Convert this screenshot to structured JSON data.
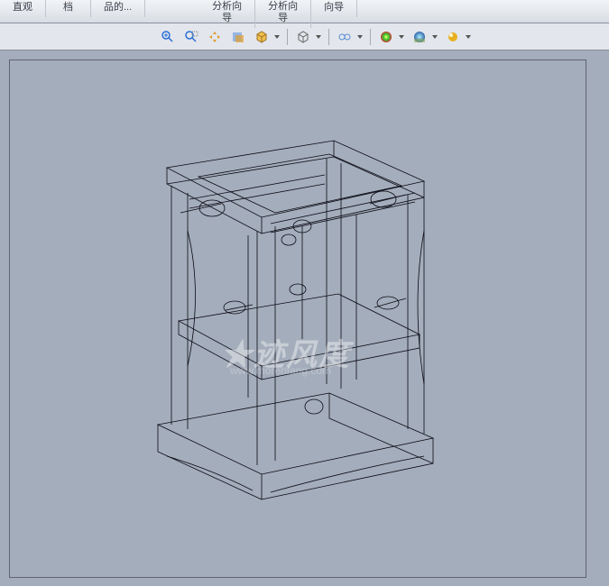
{
  "menu": {
    "view": "直观",
    "dang": "档",
    "pinde": "品的...",
    "analysis_wizard1_l1": "分析向",
    "analysis_wizard1_l2": "导",
    "analysis_wizard2_l1": "分析向",
    "analysis_wizard2_l2": "导",
    "wizard": "向导"
  },
  "watermark": {
    "main": "★迹风度",
    "sub": "www.morenfang.com"
  },
  "icons": {
    "zoom_fit": "zoom-fit",
    "zoom_window": "zoom-window",
    "pan": "pan",
    "section": "section",
    "view_orient": "view-orientation",
    "display_style": "display-style",
    "hide_show": "hide-show",
    "appearance": "appearance",
    "scene": "scene",
    "render": "render"
  }
}
